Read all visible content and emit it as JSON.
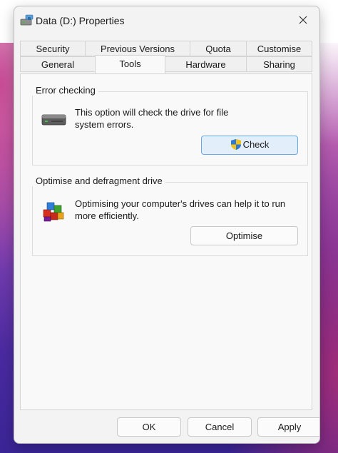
{
  "window": {
    "title": "Data (D:) Properties"
  },
  "tabs": {
    "row1": [
      "Security",
      "Previous Versions",
      "Quota",
      "Customise"
    ],
    "row2": [
      "General",
      "Tools",
      "Hardware",
      "Sharing"
    ],
    "active": "Tools"
  },
  "error_checking": {
    "title": "Error checking",
    "description_line1": "This option will check the drive for file",
    "description_line2": "system errors.",
    "button": "Check"
  },
  "optimise": {
    "title": "Optimise and defragment drive",
    "description_line1": "Optimising your computer's drives can help it to run",
    "description_line2": "more efficiently.",
    "button": "Optimise"
  },
  "footer": {
    "ok": "OK",
    "cancel": "Cancel",
    "apply": "Apply"
  },
  "colors": {
    "accent": "#6aa7e6",
    "window_bg": "#f3f3f3",
    "desktop_purple": "#4a2aa0"
  },
  "icons": [
    "drive-icon",
    "close-icon",
    "hard-drive-icon",
    "uac-shield-icon",
    "defrag-icon"
  ]
}
